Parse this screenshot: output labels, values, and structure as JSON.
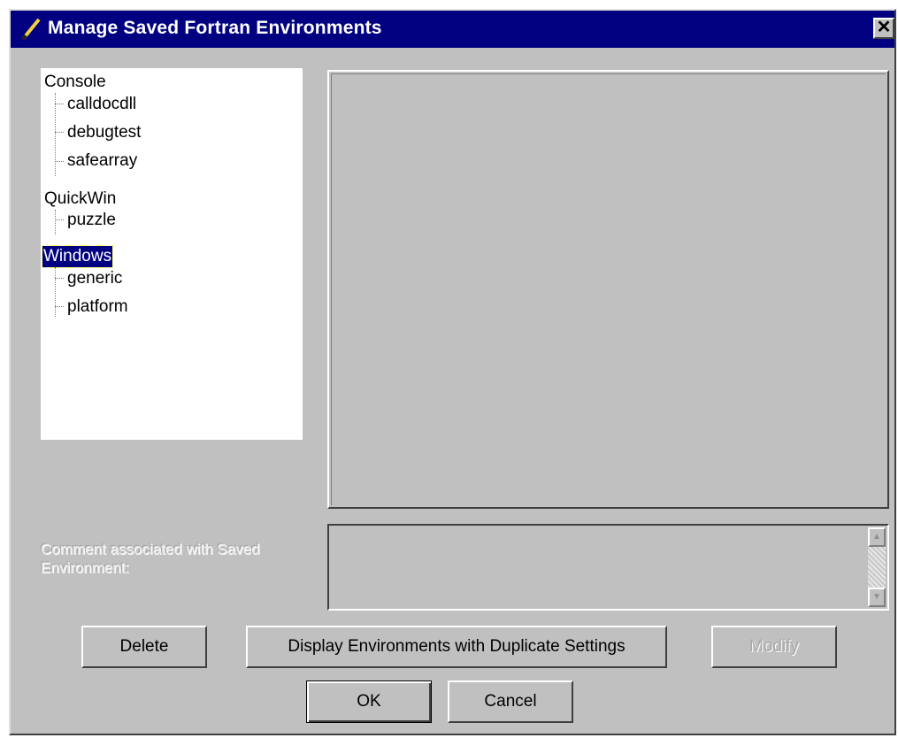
{
  "window": {
    "title": "Manage Saved Fortran Environments",
    "close_glyph": "✕",
    "title_icon": "pencil-icon",
    "colors": {
      "titlebar": "#000080",
      "face": "#c0c0c0",
      "selection": "#000080"
    }
  },
  "tree": {
    "groups": [
      {
        "label": "Console",
        "children": [
          "calldocdll",
          "debugtest",
          "safearray"
        ]
      },
      {
        "label": "QuickWin",
        "children": [
          "puzzle"
        ]
      },
      {
        "label": "Windows",
        "children": [
          "generic",
          "platform"
        ],
        "selected": true
      }
    ]
  },
  "comment": {
    "label": "Comment associated with Saved Environment:",
    "value": "",
    "scroll_up_icon": "scroll-up-arrow-icon",
    "scroll_down_icon": "scroll-down-arrow-icon"
  },
  "buttons": {
    "delete": "Delete",
    "display_duplicates": "Display Environments with Duplicate Settings",
    "modify": "Modify",
    "ok": "OK",
    "cancel": "Cancel"
  }
}
